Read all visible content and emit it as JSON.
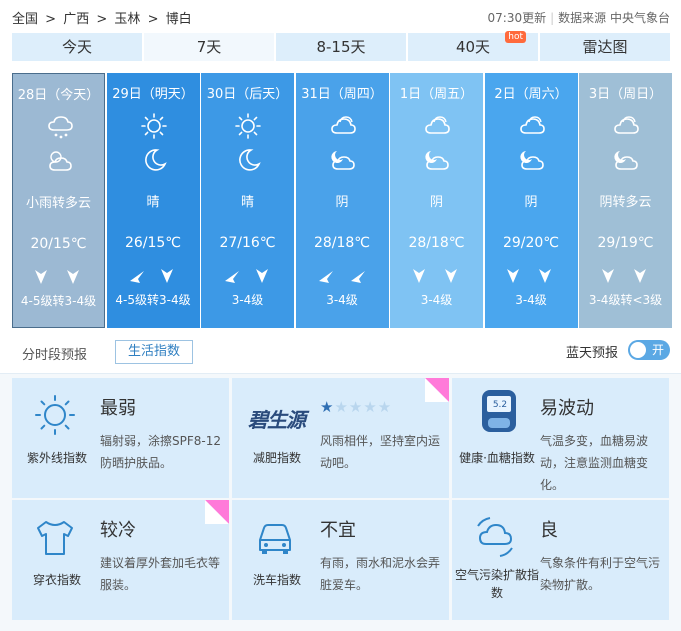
{
  "breadcrumb": [
    "全国",
    ">",
    "广西",
    ">",
    "玉林",
    ">",
    "博白"
  ],
  "update_time": "07:30更新",
  "data_source": "数据来源 中央气象台",
  "tabs": [
    {
      "label": "今天",
      "active": false
    },
    {
      "label": "7天",
      "active": true
    },
    {
      "label": "8-15天",
      "active": false
    },
    {
      "label": "40天",
      "badge": "hot",
      "active": false
    },
    {
      "label": "雷达图",
      "active": false
    }
  ],
  "days": [
    {
      "date": "28日（今天）",
      "icon_day": "cloud-rain-icon",
      "icon_night": "partly-cloudy-icon",
      "condition": "小雨转多云",
      "temp": "20/15℃",
      "wind_dirs": [
        "north-wind-icon",
        "north-wind-icon"
      ],
      "wind_level": "4-5级转3-4级",
      "bg": "#9cb9d3",
      "today": true
    },
    {
      "date": "29日（明天）",
      "icon_day": "sun-icon",
      "icon_night": "moon-icon",
      "condition": "晴",
      "temp": "26/15℃",
      "wind_dirs": [
        "northeast-wind-icon",
        "north-wind-icon"
      ],
      "wind_level": "4-5级转3-4级",
      "bg": "#2f8ee0"
    },
    {
      "date": "30日（后天）",
      "icon_day": "sun-icon",
      "icon_night": "moon-icon",
      "condition": "晴",
      "temp": "27/16℃",
      "wind_dirs": [
        "northeast-wind-icon",
        "north-wind-icon"
      ],
      "wind_level": "3-4级",
      "bg": "#3d99e6"
    },
    {
      "date": "31日（周四）",
      "icon_day": "cloudy-icon",
      "icon_night": "partly-cloudy-night-icon",
      "condition": "阴",
      "temp": "28/18℃",
      "wind_dirs": [
        "northeast-wind-icon",
        "northeast-wind-icon"
      ],
      "wind_level": "3-4级",
      "bg": "#4aa2ea"
    },
    {
      "date": "1日（周五）",
      "icon_day": "cloudy-icon",
      "icon_night": "partly-cloudy-night-icon",
      "condition": "阴",
      "temp": "28/18℃",
      "wind_dirs": [
        "north-wind-icon",
        "north-wind-icon"
      ],
      "wind_level": "3-4级",
      "bg": "#7fc3f3"
    },
    {
      "date": "2日（周六）",
      "icon_day": "cloudy-icon",
      "icon_night": "partly-cloudy-night-icon",
      "condition": "阴",
      "temp": "29/20℃",
      "wind_dirs": [
        "north-wind-icon",
        "north-wind-icon"
      ],
      "wind_level": "3-4级",
      "bg": "#4aa6ee"
    },
    {
      "date": "3日（周日）",
      "icon_day": "cloudy-icon",
      "icon_night": "partly-cloudy-night-icon",
      "condition": "阴转多云",
      "temp": "29/19℃",
      "wind_dirs": [
        "north-wind-icon",
        "north-wind-icon"
      ],
      "wind_level": "3-4级转<3级",
      "bg": "#9fbfd6"
    }
  ],
  "subtabs": {
    "hourly": "分时段预报",
    "life": "生活指数"
  },
  "blue_forecast": {
    "label": "蓝天预报",
    "toggle": "开"
  },
  "life_indices": [
    {
      "name": "紫外线指数",
      "level": "最弱",
      "desc": "辐射弱，涂擦SPF8-12防晒护肤品。",
      "icon": "sun-uv-icon"
    },
    {
      "name": "减肥指数",
      "logo": "碧生源",
      "stars": "★★★★★",
      "rating": 1,
      "desc": "风雨相伴，坚持室内运动吧。",
      "icon": "brand-logo-icon",
      "ad": true
    },
    {
      "name": "健康·血糖指数",
      "level": "易波动",
      "desc": "气温多变，血糖易波动，注意监测血糖变化。",
      "icon": "glucose-meter-icon",
      "meter_value": "5.2"
    },
    {
      "name": "穿衣指数",
      "level": "较冷",
      "desc": "建议着厚外套加毛衣等服装。",
      "icon": "tshirt-icon",
      "ad": true
    },
    {
      "name": "洗车指数",
      "level": "不宜",
      "desc": "有雨，雨水和泥水会弄脏爱车。",
      "icon": "car-icon"
    },
    {
      "name": "空气污染扩散指数",
      "level": "良",
      "desc": "气象条件有利于空气污染物扩散。",
      "icon": "air-diffusion-icon"
    }
  ]
}
